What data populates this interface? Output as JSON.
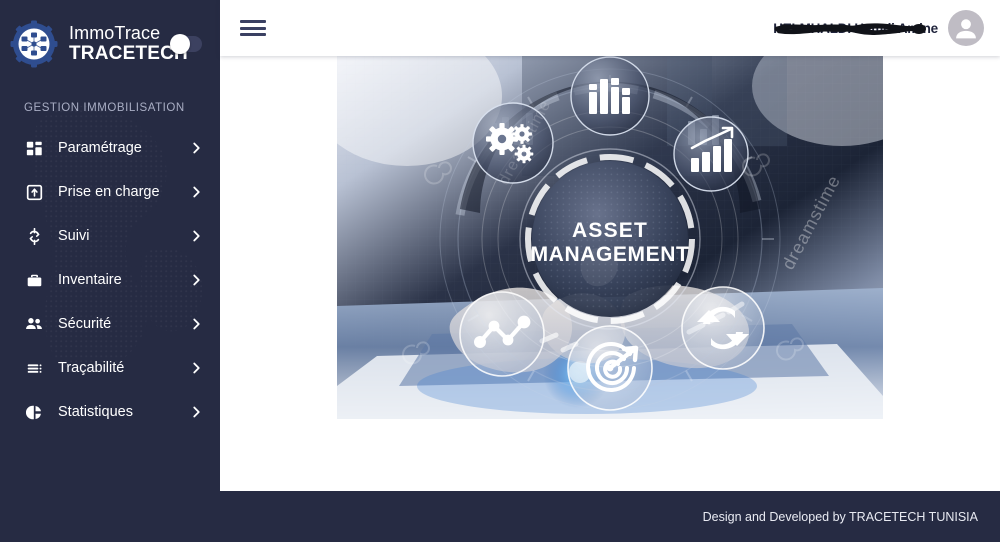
{
  "brand": {
    "logo_icon": "gear-network-logo",
    "line1": "ImmoTrace",
    "line2": "TRACETECH",
    "toggle_icon": "sidebar-collapse-toggle"
  },
  "sidebar": {
    "section_label": "GESTION IMMOBILISATION",
    "items": [
      {
        "label": "Paramétrage",
        "icon": "dashboard-grid-icon",
        "chevron": "chevron-right-icon"
      },
      {
        "label": "Prise en charge",
        "icon": "upload-box-icon",
        "chevron": "chevron-right-icon"
      },
      {
        "label": "Suivi",
        "icon": "refresh-cycle-icon",
        "chevron": "chevron-right-icon"
      },
      {
        "label": "Inventaire",
        "icon": "briefcase-icon",
        "chevron": "chevron-right-icon"
      },
      {
        "label": "Sécurité",
        "icon": "users-group-icon",
        "chevron": "chevron-right-icon"
      },
      {
        "label": "Traçabilité",
        "icon": "list-lines-icon",
        "chevron": "chevron-right-icon"
      },
      {
        "label": "Statistiques",
        "icon": "pie-chart-icon",
        "chevron": "chevron-right-icon"
      }
    ]
  },
  "topbar": {
    "menu_icon": "hamburger-menu-icon",
    "user_name": "HELMHALDI Hamdi Amine",
    "name_redacted": true,
    "avatar_icon": "user-avatar-icon"
  },
  "content": {
    "hero": {
      "image_alt": "asset-management-hero-image",
      "center_title_line1": "ASSET",
      "center_title_line2": "MANAGEMENT",
      "watermark": "dreamstime",
      "orbit_icons": [
        {
          "name": "gears-icon",
          "position": "left"
        },
        {
          "name": "bar-chart-icon",
          "position": "top"
        },
        {
          "name": "growth-chart-icon",
          "position": "right"
        },
        {
          "name": "network-nodes-icon",
          "position": "bottom-left"
        },
        {
          "name": "target-arrow-icon",
          "position": "bottom"
        },
        {
          "name": "sync-refresh-icon",
          "position": "bottom-right"
        }
      ]
    }
  },
  "footer": {
    "text": "Design and Developed by TRACETECH TUNISIA"
  },
  "colors": {
    "sidebar_bg": "#262b43",
    "footer_bg": "#262b43",
    "content_bg": "#ffffff",
    "accent_blue": "#2f4d8f",
    "topbar_bg": "#ffffff",
    "text_light": "#ffffff",
    "muted_label": "#a9aec4"
  }
}
